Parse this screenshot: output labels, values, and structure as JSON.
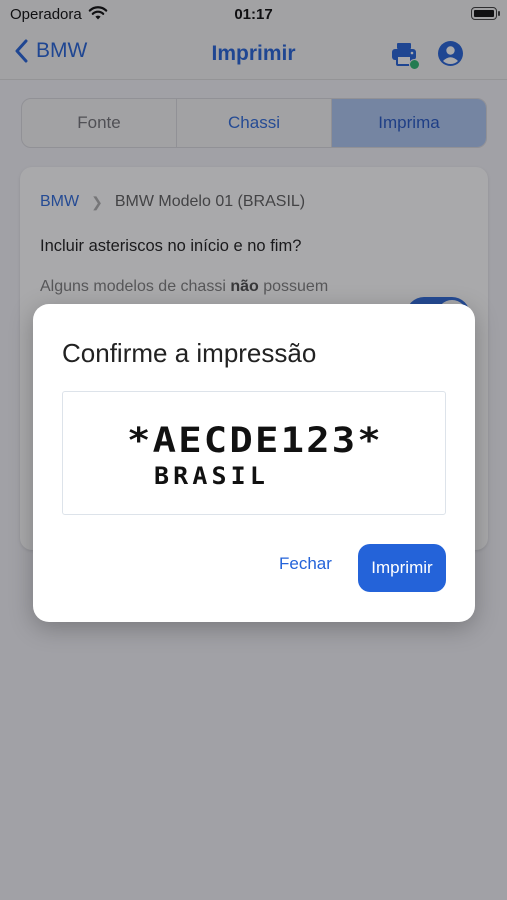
{
  "status": {
    "carrier": "Operadora",
    "time": "01:17"
  },
  "nav": {
    "back_label": "BMW",
    "title": "Imprimir",
    "accent_color": "#2463d9",
    "print_status_color": "#21b36a"
  },
  "tabs": [
    {
      "label": "Fonte",
      "active": false
    },
    {
      "label": "Chassi",
      "active": false
    },
    {
      "label": "Imprima",
      "active": true
    }
  ],
  "card": {
    "breadcrumb": [
      "BMW",
      "BMW Modelo 01 (BRASIL)"
    ],
    "question": "Incluir asteriscos no início e no fim?",
    "hint_start": "Alguns modelos de chassi ",
    "hint_bold": "não",
    "hint_end": " possuem",
    "toggle_on": true
  },
  "dialog": {
    "title": "Confirme a impressão",
    "preview_line1": "*AECDE123*",
    "preview_line2": "BRASIL",
    "close_label": "Fechar",
    "print_label": "Imprimir"
  }
}
